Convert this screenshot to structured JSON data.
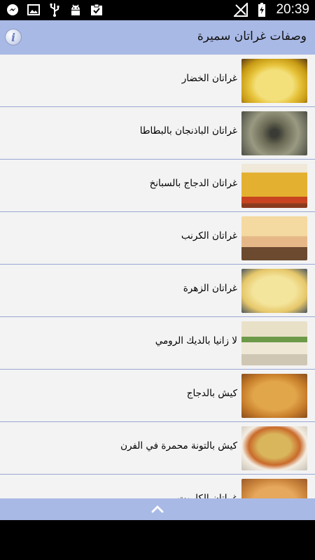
{
  "status_bar": {
    "time": "20:39",
    "left_icons": [
      "messenger-icon",
      "image-icon",
      "usb-icon",
      "android-debug-icon",
      "clipboard-check-icon"
    ],
    "right_icons": [
      "signal-off-icon",
      "battery-charging-icon"
    ]
  },
  "app_bar": {
    "title": "وصفات غراتان سميرة",
    "info_icon": "i"
  },
  "recipes": [
    {
      "label": "غراتان الخضار"
    },
    {
      "label": "غراتان الباذنجان بالبطاطا"
    },
    {
      "label": "غراتان الدجاج بالسبانخ"
    },
    {
      "label": "غراتان الكرنب"
    },
    {
      "label": "غراتان الزهرة"
    },
    {
      "label": "لا زانيا بالديك الرومي"
    },
    {
      "label": "كيش بالدجاج"
    },
    {
      "label": "كيش بالتونة محمرة في الفرن"
    },
    {
      "label": "غراتان الكاروت"
    }
  ],
  "colors": {
    "appbar": "#a9b9e6",
    "divider": "#9aa6d4",
    "list_bg": "#f3f3f3"
  }
}
